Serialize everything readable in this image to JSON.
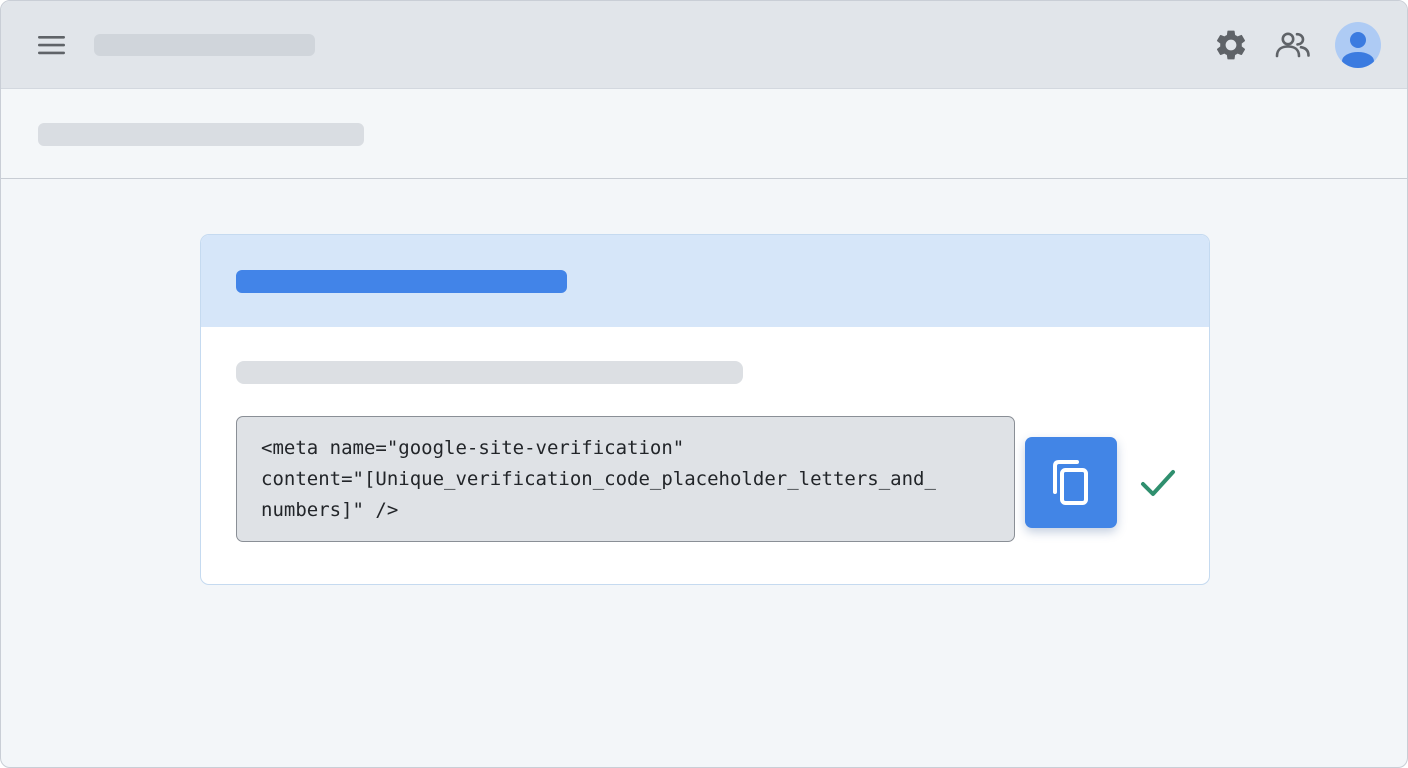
{
  "app": {
    "icons": {
      "menu": "hamburger-menu-icon",
      "settings": "gear-icon",
      "people": "people-icon",
      "avatar": "person-avatar-icon"
    }
  },
  "card": {
    "code_lines": [
      "<meta name=\"google-site-verification\"",
      "content=\"[Unique_verification_code_placeholder_letters_and_",
      "numbers]\" />"
    ],
    "icons": {
      "copy": "copy-icon",
      "success": "checkmark-icon"
    }
  },
  "colors": {
    "accent": "#4285e6",
    "header_band": "#d6e6f9",
    "success": "#2f8f6e",
    "icon_gray": "#5f6368"
  }
}
